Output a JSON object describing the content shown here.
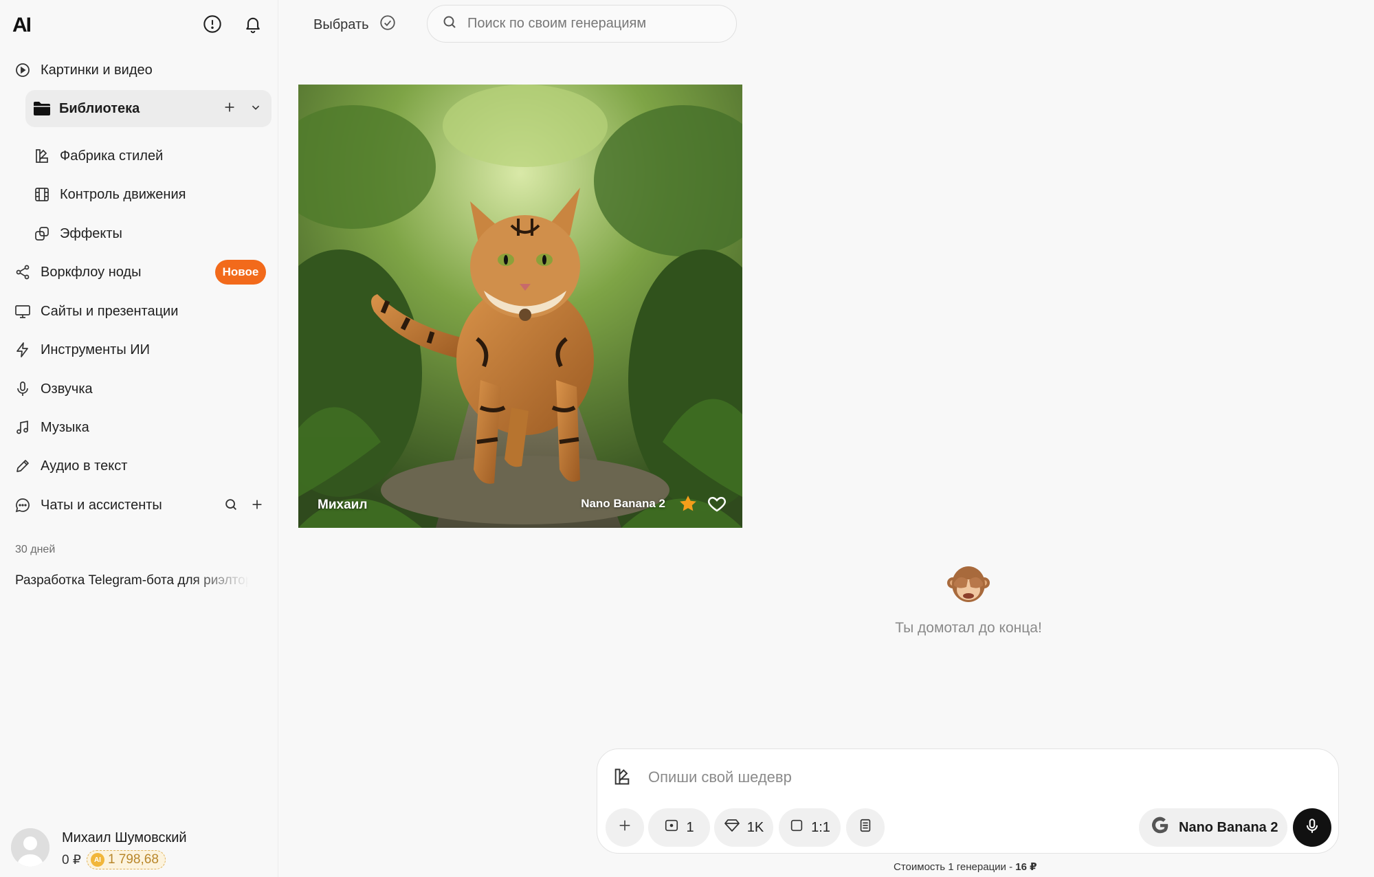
{
  "brand": {
    "logo_text": "AI"
  },
  "sidebar": {
    "items": [
      {
        "label": "Картинки и видео",
        "icon": "play-circle-icon"
      },
      {
        "label": "Библиотека",
        "icon": "folder-icon"
      },
      {
        "label": "Фабрика стилей",
        "icon": "style-icon"
      },
      {
        "label": "Контроль движения",
        "icon": "film-icon"
      },
      {
        "label": "Эффекты",
        "icon": "effects-icon"
      },
      {
        "label": "Воркфлоу ноды",
        "icon": "share-nodes-icon",
        "badge": "Новое"
      },
      {
        "label": "Сайты и презентации",
        "icon": "monitor-icon"
      },
      {
        "label": "Инструменты ИИ",
        "icon": "bolt-icon"
      },
      {
        "label": "Озвучка",
        "icon": "microphone-icon"
      },
      {
        "label": "Музыка",
        "icon": "music-note-icon"
      },
      {
        "label": "Аудио в текст",
        "icon": "pen-icon"
      },
      {
        "label": "Чаты и ассистенты",
        "icon": "chat-bubble-icon"
      }
    ],
    "history_section": "30 дней",
    "history": [
      "Разработка Telegram-бота для риэлторов"
    ],
    "badge_color": "#f26a1b"
  },
  "user": {
    "name": "Михаил Шумовский",
    "balance_rub": "0 ₽",
    "coins": "1 798,68"
  },
  "toolbar": {
    "select_label": "Выбрать",
    "search_placeholder": "Поиск по своим генерациям"
  },
  "gallery": [
    {
      "author": "Михаил",
      "model": "Nano Banana 2",
      "starred": true,
      "liked": false
    }
  ],
  "end_message": "Ты домотал до конца!",
  "composer": {
    "placeholder": "Опиши свой шедевр",
    "count": "1",
    "quality": "1K",
    "ratio": "1:1",
    "model": "Nano Banana 2",
    "cost_prefix": "Стоимость 1 генерации - ",
    "cost_value": "16 ₽"
  }
}
